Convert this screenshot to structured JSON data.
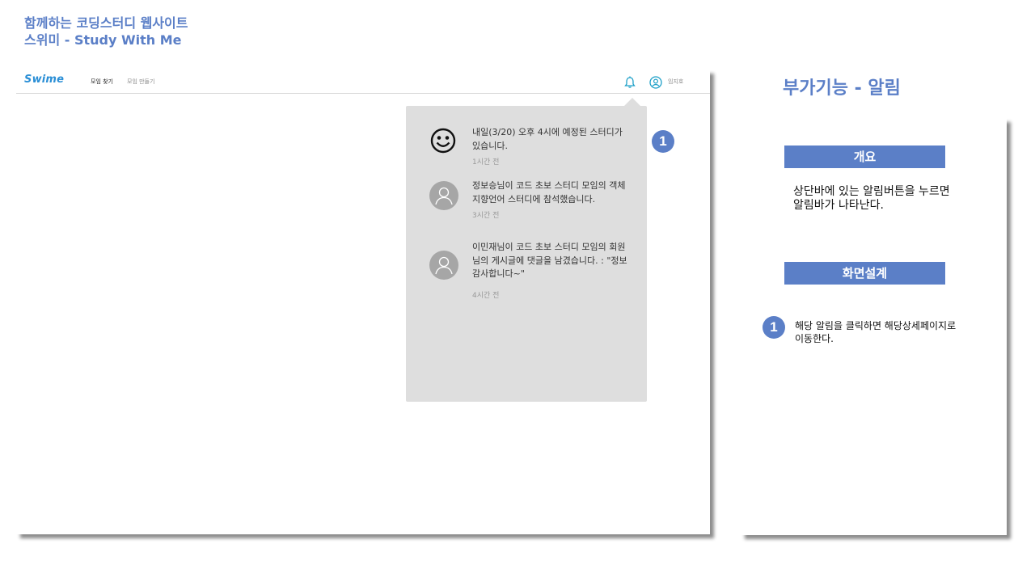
{
  "doc": {
    "title_line1": "함께하는 코딩스터디 웹사이트",
    "title_line2": "스위미 - Study With Me"
  },
  "header": {
    "logo": "Swime",
    "nav": [
      "모임 찾기",
      "모임 만들기"
    ],
    "username": "임지호"
  },
  "notifications": [
    {
      "text": "내일(3/20) 오후 4시에 예정된 스터디가 있습니다.",
      "time": "1시간 전",
      "icon": "smiley-icon"
    },
    {
      "text": "정보승님이 코드 초보 스터디 모임의 객체 지향언어 스터디에 참석했습니다.",
      "time": "3시간 전",
      "icon": "default-avatar-icon"
    },
    {
      "text": "이민재님이 코드 초보 스터디 모임의 회원님의 게시글에 댓글을 남겼습니다. : \"정보 감사합니다~\"",
      "time": "4시간 전",
      "icon": "default-avatar-icon"
    }
  ],
  "badges": {
    "one": "1"
  },
  "side": {
    "title": "부가기능 - 알림",
    "overview_header": "개요",
    "overview_text": "상단바에 있는 알림버튼을 누르면 알림바가 나타난다.",
    "design_header": "화면설계",
    "item1_text": "해당 알림을 클릭하면 해당상세페이지로 이동한다."
  },
  "colors": {
    "accent": "#5b7fc7",
    "logo": "#2b8fd6",
    "icon": "#1ea0c8",
    "popup_bg": "#dedede"
  }
}
